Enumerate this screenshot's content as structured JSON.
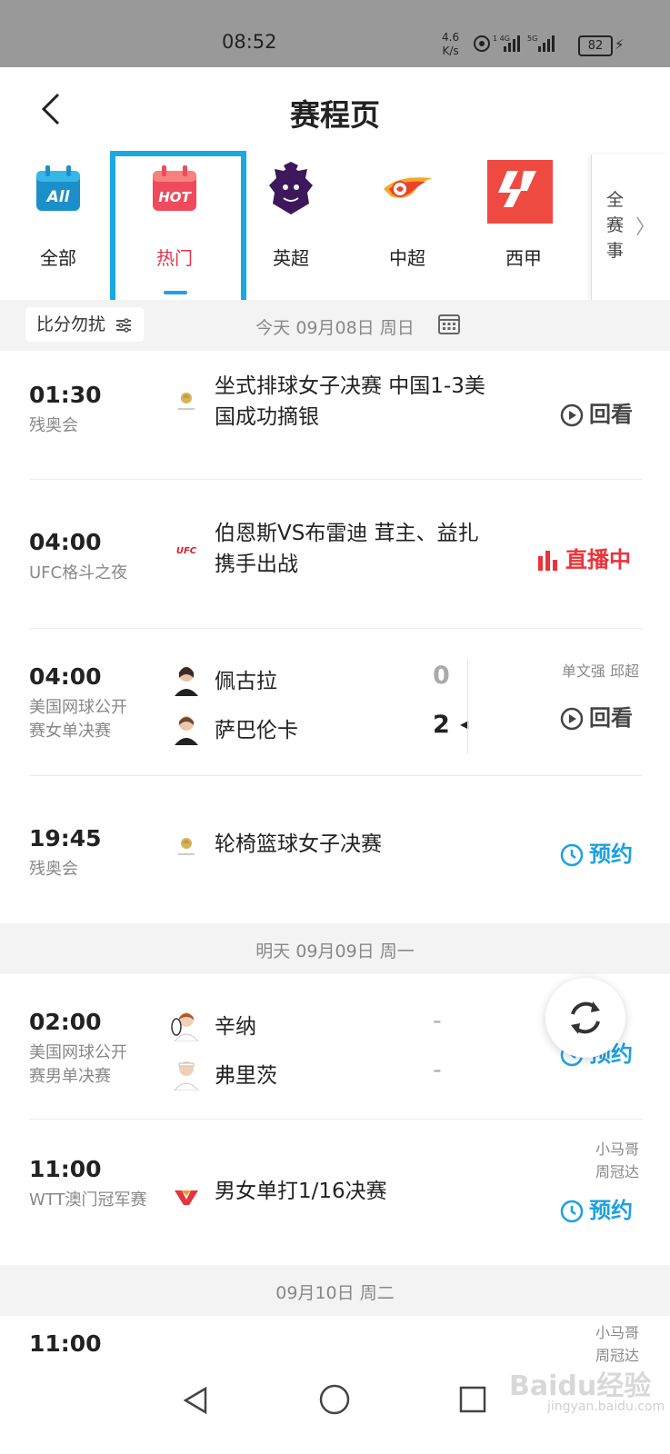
{
  "status_bar": {
    "time": "08:52",
    "net_speed_top": "4.6",
    "net_speed_bottom": "K/s",
    "battery": "82"
  },
  "header": {
    "title": "赛程页"
  },
  "tabs": [
    {
      "label": "全部",
      "icon": "calendar-all-icon",
      "active": false
    },
    {
      "label": "热门",
      "icon": "calendar-hot-icon",
      "active": true
    },
    {
      "label": "英超",
      "icon": "premier-league-lion-icon",
      "active": false
    },
    {
      "label": "中超",
      "icon": "csl-fire-ball-icon",
      "active": false
    },
    {
      "label": "西甲",
      "icon": "laliga-logo-icon",
      "active": false
    }
  ],
  "all_events": {
    "label": "全赛事"
  },
  "filter": {
    "label": "比分勿扰"
  },
  "days": [
    {
      "label": "今天 09月08日 周日"
    },
    {
      "label": "明天 09月09日 周一"
    },
    {
      "label": "09月10日 周二"
    }
  ],
  "matches": [
    {
      "time": "01:30",
      "competition": "残奥会",
      "desc": "坐式排球女子决赛 中国1-3美国成功摘银",
      "action": "回看",
      "logo": "paralympics-logo-icon"
    },
    {
      "time": "04:00",
      "competition": "UFC格斗之夜",
      "desc": "伯恩斯VS布雷迪 茸主、益扎携手出战",
      "action": "直播中",
      "logo": "ufc-logo-icon"
    },
    {
      "time": "04:00",
      "competition": "美国网球公开赛女单决赛",
      "player1": "佩古拉",
      "score1": "0",
      "player2": "萨巴伦卡",
      "score2": "2",
      "commentators": "单文强 邱超",
      "action": "回看"
    },
    {
      "time": "19:45",
      "competition": "残奥会",
      "desc": "轮椅篮球女子决赛",
      "action": "预约",
      "logo": "paralympics-logo-icon"
    },
    {
      "time": "02:00",
      "competition": "美国网球公开赛男单决赛",
      "player1": "辛纳",
      "score1": "-",
      "player2": "弗里茨",
      "score2": "-",
      "action": "预约"
    },
    {
      "time": "11:00",
      "competition": "WTT澳门冠军赛",
      "desc": "男女单打1/16决赛",
      "commentator1": "小马哥",
      "commentator2": "周冠达",
      "action": "预约",
      "logo": "wtt-logo-icon"
    },
    {
      "time": "11:00",
      "commentator1": "小马哥",
      "commentator2": "周冠达"
    }
  ],
  "watermark": {
    "brand": "Baidu经验",
    "url": "jingyan.baidu.com"
  },
  "colors": {
    "accent_blue": "#1ba0e6",
    "hot_red": "#e5334b",
    "live_red": "#e8343a",
    "highlight_box": "#19a8e0"
  }
}
